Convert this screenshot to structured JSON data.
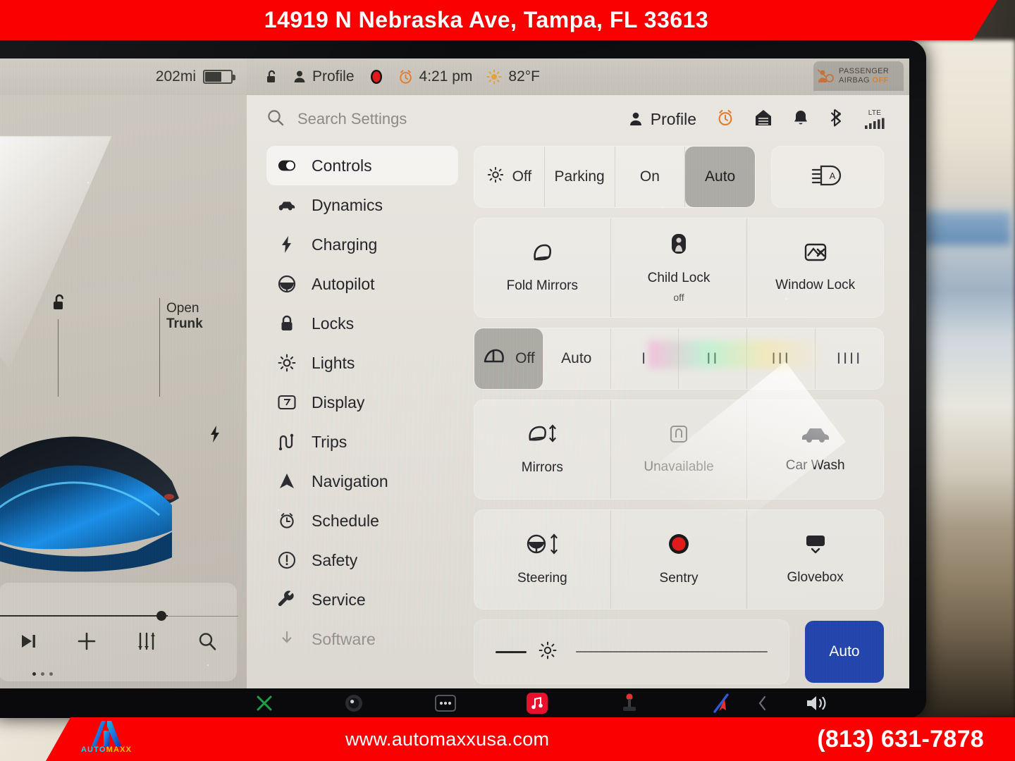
{
  "dealer": {
    "address": "14919 N Nebraska Ave, Tampa, FL 33613",
    "website": "www.automaxxusa.com",
    "phone": "(813) 631-7878",
    "logo_auto": "AUTO",
    "logo_maxx": "MAXX",
    "banner_color": "#fb0000"
  },
  "status_bar": {
    "range": "202mi",
    "profile": "Profile",
    "time": "4:21 pm",
    "temperature": "82°F",
    "airbag_line1": "PASSENGER",
    "airbag_line2": "AIRBAG",
    "airbag_state": "OFF",
    "icons": [
      "battery-icon",
      "unlock-icon",
      "person-icon",
      "sentry-record-icon",
      "alarm-clock-icon",
      "sun-icon"
    ]
  },
  "car_panel": {
    "trunk_label_line1": "Open",
    "trunk_label_line2": "Trunk",
    "icons": [
      "unlock-icon",
      "charge-bolt-icon"
    ],
    "vehicle_color": "#1b8fe8"
  },
  "media": {
    "icons": [
      "skip-next-icon",
      "plus-icon",
      "equalizer-icon",
      "search-icon"
    ],
    "progress_percent": 66
  },
  "settings": {
    "search_placeholder": "Search Settings",
    "profile_label": "Profile",
    "connection": "LTE",
    "header_icons": [
      "person-icon",
      "alarm-clock-icon",
      "garage-icon",
      "bell-icon",
      "bluetooth-icon",
      "signal-icon"
    ],
    "nav_items": [
      {
        "label": "Controls",
        "icon": "toggle-icon",
        "state": "active"
      },
      {
        "label": "Dynamics",
        "icon": "car-icon",
        "state": "normal"
      },
      {
        "label": "Charging",
        "icon": "bolt-icon",
        "state": "normal"
      },
      {
        "label": "Autopilot",
        "icon": "steering-icon",
        "state": "normal"
      },
      {
        "label": "Locks",
        "icon": "lock-icon",
        "state": "normal"
      },
      {
        "label": "Lights",
        "icon": "sun-icon",
        "state": "normal"
      },
      {
        "label": "Display",
        "icon": "display-icon",
        "state": "normal"
      },
      {
        "label": "Trips",
        "icon": "trips-icon",
        "state": "normal"
      },
      {
        "label": "Navigation",
        "icon": "navarrow-icon",
        "state": "normal"
      },
      {
        "label": "Schedule",
        "icon": "schedule-icon",
        "state": "normal"
      },
      {
        "label": "Safety",
        "icon": "warning-icon",
        "state": "normal"
      },
      {
        "label": "Service",
        "icon": "wrench-icon",
        "state": "normal"
      },
      {
        "label": "Software",
        "icon": "download-icon",
        "state": "dim"
      }
    ],
    "lights_segment": {
      "options": [
        "Off",
        "Parking",
        "On",
        "Auto"
      ],
      "selected": "Auto",
      "aux_icon": "auto-highbeam-icon"
    },
    "mirror_tiles": [
      {
        "label": "Fold Mirrors",
        "sub": "",
        "icon": "mirror-icon",
        "state": "normal"
      },
      {
        "label": "Child Lock",
        "sub": "off",
        "icon": "child-lock-icon",
        "state": "normal"
      },
      {
        "label": "Window Lock",
        "sub": "",
        "icon": "window-lock-icon",
        "state": "normal"
      }
    ],
    "wiper_segment": {
      "icon": "wiper-icon",
      "options": [
        "Off",
        "Auto",
        "I",
        "II",
        "III",
        "IIII"
      ],
      "selected": "Off"
    },
    "action_tiles_row1": [
      {
        "label": "Mirrors",
        "icon": "mirror-adjust-icon",
        "state": "normal"
      },
      {
        "label": "Unavailable",
        "icon": "seat-icon",
        "state": "muted"
      },
      {
        "label": "Car Wash",
        "icon": "car-wash-icon",
        "state": "normal"
      }
    ],
    "action_tiles_row2": [
      {
        "label": "Steering",
        "icon": "steering-adjust-icon",
        "state": "normal"
      },
      {
        "label": "Sentry",
        "icon": "sentry-icon",
        "state": "normal"
      },
      {
        "label": "Glovebox",
        "icon": "glovebox-icon",
        "state": "normal"
      }
    ],
    "brightness": {
      "icon": "brightness-icon",
      "value_percent": 0,
      "auto_label": "Auto",
      "auto_color": "#2345ac"
    }
  },
  "taskbar": {
    "icons": [
      "bluetooth-x-icon",
      "camera-icon",
      "more-icon",
      "music-icon",
      "joystick-icon",
      "navigation-icon",
      "back-chevron-icon",
      "volume-icon"
    ]
  }
}
